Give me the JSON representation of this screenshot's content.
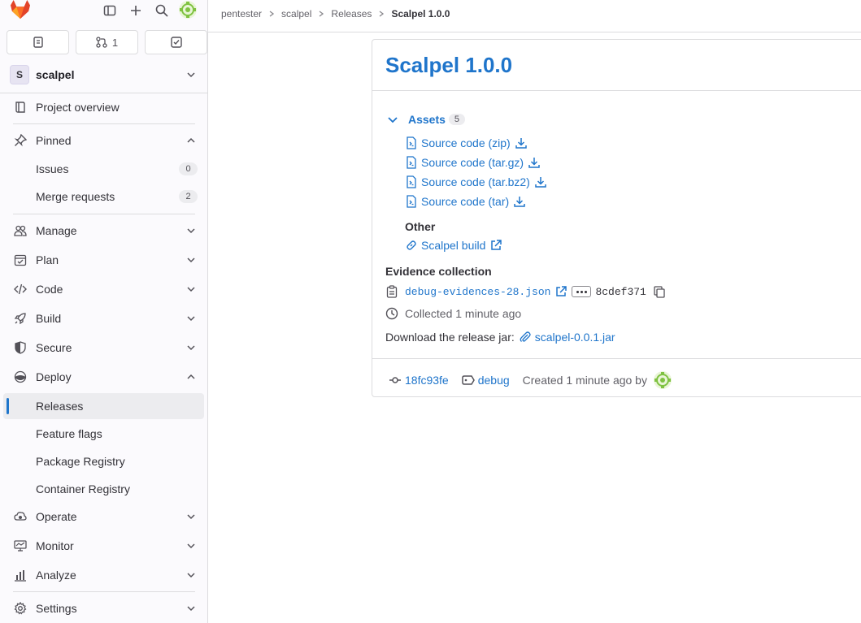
{
  "sidebar": {
    "merge_count": "1",
    "project": {
      "initial": "S",
      "name": "scalpel"
    },
    "overview_label": "Project overview",
    "pinned": {
      "label": "Pinned",
      "items": [
        {
          "label": "Issues",
          "count": "0"
        },
        {
          "label": "Merge requests",
          "count": "2"
        }
      ]
    },
    "sections": {
      "manage": "Manage",
      "plan": "Plan",
      "code": "Code",
      "build": "Build",
      "secure": "Secure",
      "deploy": "Deploy",
      "operate": "Operate",
      "monitor": "Monitor",
      "analyze": "Analyze",
      "settings": "Settings"
    },
    "deploy_items": {
      "releases": "Releases",
      "feature_flags": "Feature flags",
      "package_registry": "Package Registry",
      "container_registry": "Container Registry"
    }
  },
  "breadcrumb": {
    "items": [
      "pentester",
      "scalpel",
      "Releases"
    ],
    "current": "Scalpel 1.0.0"
  },
  "release": {
    "title": "Scalpel 1.0.0",
    "assets_label": "Assets",
    "assets_count": "5",
    "sources": [
      "Source code (zip)",
      "Source code (tar.gz)",
      "Source code (tar.bz2)",
      "Source code (tar)"
    ],
    "other_label": "Other",
    "other_links": [
      "Scalpel build"
    ],
    "evidence_label": "Evidence collection",
    "evidence_file": "debug-evidences-28.json",
    "evidence_sha": "8cdef371",
    "collected": "Collected 1 minute ago",
    "download_text": "Download the release jar:",
    "jar_name": "scalpel-0.0.1.jar",
    "commit": "18fc93fe",
    "tag": "debug",
    "created": "Created 1 minute ago by"
  },
  "colors": {
    "link": "#1f75cb",
    "text": "#333238",
    "muted": "#626168",
    "border": "#dcdcde",
    "sidebar_bg": "#fbfafd",
    "gitlab_orange": "#e24329"
  }
}
